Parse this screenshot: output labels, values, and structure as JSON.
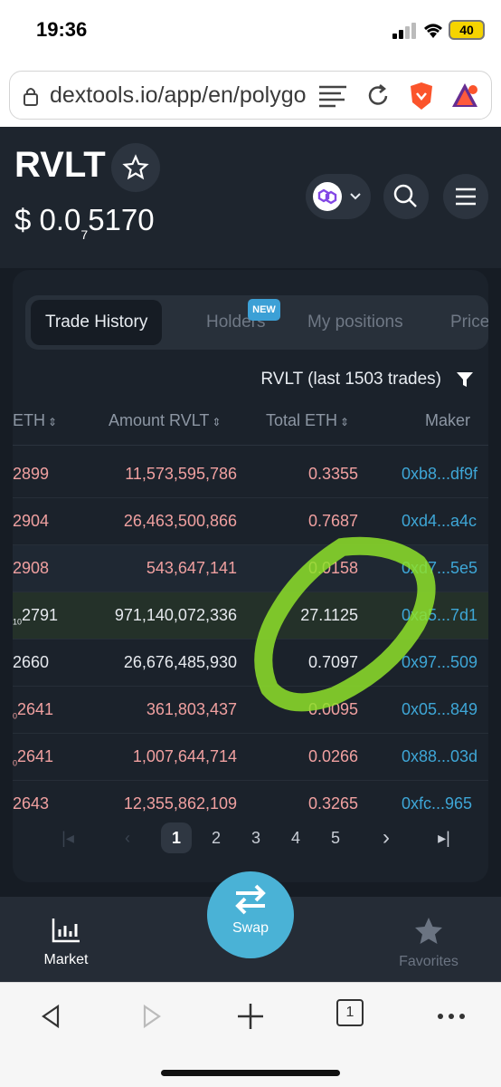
{
  "status_bar": {
    "time": "19:36",
    "battery": "40"
  },
  "browser": {
    "url": "dextools.io/app/en/polygon",
    "tab_count": "1"
  },
  "header": {
    "token": "RVLT",
    "price_prefix": "$ 0.0",
    "price_zeros": "7",
    "price_digits": "5170"
  },
  "tabs": {
    "trade_history": "Trade History",
    "holders": "Holders",
    "new_badge": "NEW",
    "my_positions": "My positions",
    "price": "Price"
  },
  "filter": {
    "label": "RVLT (last 1503 trades)"
  },
  "table": {
    "headers": {
      "col1": "ETH",
      "amount": "Amount RVLT",
      "total": "Total ETH",
      "maker": "Maker"
    },
    "rows": [
      {
        "price": "2899",
        "amount": "11,573,595,786",
        "total": "0.3355",
        "maker": "0xb8...df9f",
        "side": "sell"
      },
      {
        "price": "2904",
        "amount": "26,463,500,866",
        "total": "0.7687",
        "maker": "0xd4...a4c",
        "side": "sell"
      },
      {
        "price": "2908",
        "amount": "543,647,141",
        "total": "0.0158",
        "maker": "0xd7...5e5",
        "side": "sell"
      },
      {
        "price_sub": "10",
        "price": "2791",
        "amount": "971,140,072,336",
        "total": "27.1125",
        "maker": "0xa5...7d1",
        "side": "buy"
      },
      {
        "price": "2660",
        "amount": "26,676,485,930",
        "total": "0.7097",
        "maker": "0x97...509",
        "side": "buy"
      },
      {
        "price_sub": "0",
        "price": "2641",
        "amount": "361,803,437",
        "total": "0.0095",
        "maker": "0x05...849",
        "side": "sell"
      },
      {
        "price_sub": "0",
        "price": "2641",
        "amount": "1,007,644,714",
        "total": "0.0266",
        "maker": "0x88...03d",
        "side": "sell"
      },
      {
        "price": "2643",
        "amount": "12,355,862,109",
        "total": "0.3265",
        "maker": "0xfc...965",
        "side": "sell"
      }
    ]
  },
  "pagination": {
    "pages": [
      "1",
      "2",
      "3",
      "4",
      "5"
    ],
    "current": "1"
  },
  "bottom_nav": {
    "market": "Market",
    "swap": "Swap",
    "favorites": "Favorites"
  },
  "colors": {
    "accent": "#4ab2d6",
    "sell": "#f0a0a0",
    "buy": "#e6e9ee",
    "maker": "#3ea6d6",
    "annotation": "#8ee02a"
  }
}
